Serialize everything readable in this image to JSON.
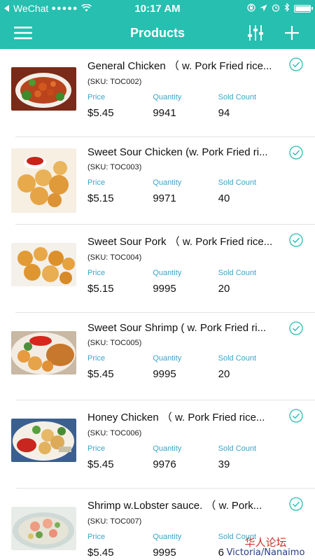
{
  "status_bar": {
    "carrier": "WeChat",
    "signal": "●●●●●",
    "time": "10:17 AM",
    "battery_level": 0.95
  },
  "nav": {
    "title": "Products",
    "menu_icon": "hamburger-menu-icon",
    "filter_icon": "sliders-filter-icon",
    "add_icon": "plus-icon",
    "color": "#26bfb0"
  },
  "labels": {
    "price": "Price",
    "quantity": "Quantity",
    "sold": "Sold Count"
  },
  "products": [
    {
      "name": "General Chicken （ w. Pork Fried rice...",
      "sku": "(SKU: TOC002)",
      "price": "$5.45",
      "quantity": "9941",
      "sold": "94"
    },
    {
      "name": "Sweet Sour Chicken (w. Pork Fried ri...",
      "sku": "(SKU: TOC003)",
      "price": "$5.15",
      "quantity": "9971",
      "sold": "40"
    },
    {
      "name": "Sweet Sour Pork （ w. Pork Fried rice...",
      "sku": "(SKU: TOC004)",
      "price": "$5.15",
      "quantity": "9995",
      "sold": "20"
    },
    {
      "name": "Sweet Sour Shrimp ( w. Pork Fried ri...",
      "sku": "(SKU: TOC005)",
      "price": "$5.45",
      "quantity": "9995",
      "sold": "20"
    },
    {
      "name": "Honey Chicken （ w. Pork Fried rice...",
      "sku": "(SKU: TOC006)",
      "price": "$5.45",
      "quantity": "9976",
      "sold": "39"
    },
    {
      "name": "Shrimp w.Lobster sauce. （ w. Pork...",
      "sku": "(SKU: TOC007)",
      "price": "$5.45",
      "quantity": "9995",
      "sold": "6"
    }
  ],
  "watermark": {
    "line1": "华人论坛",
    "line2": "Victoria/Nanaimo"
  }
}
